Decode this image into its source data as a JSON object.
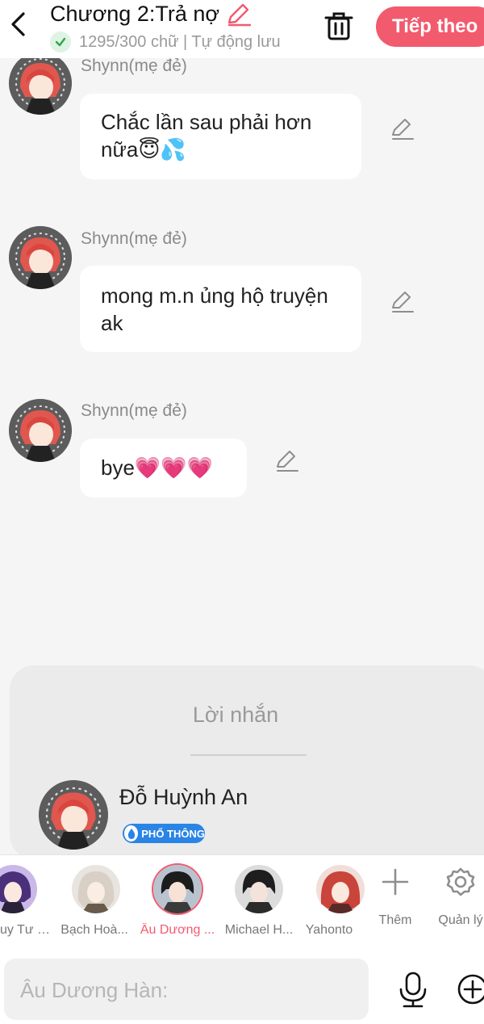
{
  "header": {
    "title": "Chương 2:Trả nợ",
    "status": "1295/300 chữ | Tự động lưu",
    "next_label": "Tiếp theo"
  },
  "colors": {
    "accent": "#f25a6e",
    "badge": "#2a84e6",
    "bubble": "#ffffff",
    "background": "#f5f5f5"
  },
  "messages": [
    {
      "sender": "Shynn(mẹ đẻ)",
      "text": "Chắc lần sau phải hơn nữa😇💦"
    },
    {
      "sender": "Shynn(mẹ đẻ)",
      "text": "mong m.n ủng hộ truyện ak"
    },
    {
      "sender": "Shynn(mẹ đẻ)",
      "text": "bye💗💗💗"
    }
  ],
  "note_panel": {
    "title": "Lời nhắn",
    "author": "Đỗ Huỳnh An",
    "badge": "PHỔ THÔNG"
  },
  "characters": [
    {
      "name": "uy Tư Đ..."
    },
    {
      "name": "Bạch Hoà..."
    },
    {
      "name": "Âu Dương ..."
    },
    {
      "name": "Michael H..."
    },
    {
      "name": "Yahonto"
    }
  ],
  "actions": {
    "more_label": "Thêm",
    "manage_label": "Quản lý"
  },
  "input": {
    "placeholder": "Âu Dương Hàn:"
  },
  "icons": [
    "back-arrow-icon",
    "pencil-icon",
    "check-icon",
    "trash-icon",
    "mic-icon",
    "plus-circle-icon",
    "gear-icon",
    "plus-icon"
  ]
}
